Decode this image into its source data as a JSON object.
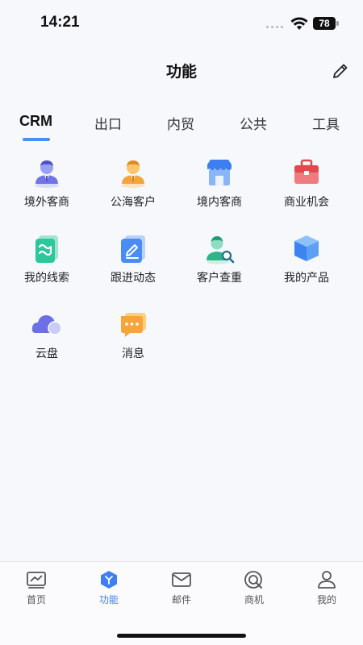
{
  "status_bar": {
    "time": "14:21",
    "battery": "78"
  },
  "header": {
    "title": "功能",
    "edit_icon": "pencil-icon"
  },
  "tabs": [
    {
      "label": "CRM",
      "active": true
    },
    {
      "label": "出口",
      "active": false
    },
    {
      "label": "内贸",
      "active": false
    },
    {
      "label": "公共",
      "active": false
    },
    {
      "label": "工具",
      "active": false
    }
  ],
  "grid": [
    {
      "label": "境外客商",
      "icon": "foreign-client-icon"
    },
    {
      "label": "公海客户",
      "icon": "public-pool-client-icon"
    },
    {
      "label": "境内客商",
      "icon": "domestic-store-icon"
    },
    {
      "label": "商业机会",
      "icon": "briefcase-icon"
    },
    {
      "label": "我的线索",
      "icon": "leads-icon"
    },
    {
      "label": "跟进动态",
      "icon": "follow-up-icon"
    },
    {
      "label": "客户查重",
      "icon": "client-search-icon"
    },
    {
      "label": "我的产品",
      "icon": "product-cube-icon"
    },
    {
      "label": "云盘",
      "icon": "cloud-icon"
    },
    {
      "label": "消息",
      "icon": "message-icon"
    }
  ],
  "bottom_nav": [
    {
      "label": "首页",
      "icon": "home-chart-icon",
      "active": false
    },
    {
      "label": "功能",
      "icon": "function-hex-icon",
      "active": true
    },
    {
      "label": "邮件",
      "icon": "mail-icon",
      "active": false
    },
    {
      "label": "商机",
      "icon": "opportunity-icon",
      "active": false
    },
    {
      "label": "我的",
      "icon": "profile-icon",
      "active": false
    }
  ],
  "colors": {
    "accent": "#3e7ef0",
    "tab_underline": "#4a8ff2"
  }
}
